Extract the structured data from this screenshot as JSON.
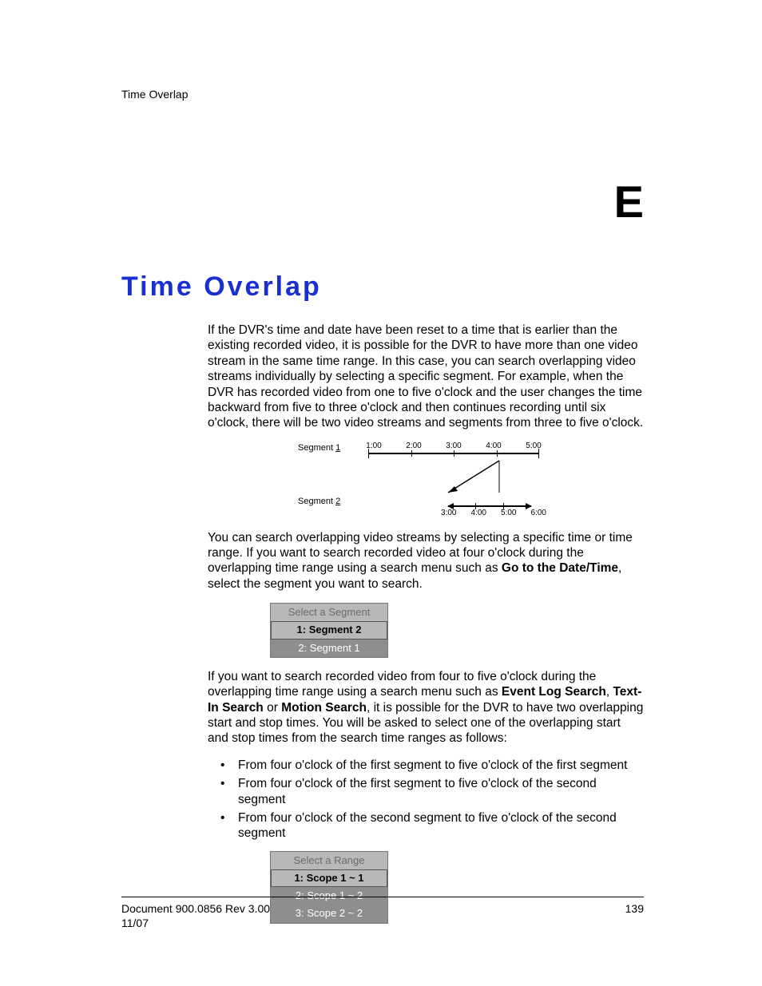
{
  "running_head": "Time Overlap",
  "section_letter": "E",
  "title": "Time Overlap",
  "para1": "If the DVR's time and date have been reset to a time that is earlier than the existing recorded video, it is possible for the DVR to have more than one video stream in the same time range. In this case, you can search overlapping video streams individually by selecting a specific segment. For example, when the DVR has recorded video from one to five o'clock and the user changes the time backward from five to three o'clock and then continues recording until six o'clock, there will be two video streams and segments from three to five o'clock.",
  "diagram": {
    "segment1_label_prefix": "Segment ",
    "segment1_label_key": "1",
    "segment1_ticks": [
      "1:00",
      "2:00",
      "3:00",
      "4:00",
      "5:00"
    ],
    "segment2_label_prefix": "Segment ",
    "segment2_label_key": "2",
    "segment2_ticks": [
      "3:00",
      "4:00",
      "5:00",
      "6:00"
    ]
  },
  "para2_pre": "You can search overlapping video streams by selecting a specific time or time range. If you want to search recorded video at four o'clock during the overlapping time range using a search menu such as ",
  "para2_bold": "Go to the Date/Time",
  "para2_post": ", select the segment you want to search.",
  "segment_menu": {
    "header": "Select a Segment",
    "rows": [
      "1: Segment 2",
      "2: Segment 1"
    ],
    "selected_index": 0
  },
  "para3_pre": "If you want to search recorded video from four to five o'clock during the overlapping time range using a search menu such as ",
  "para3_bold1": "Event Log Search",
  "para3_sep1": ", ",
  "para3_bold2": "Text-In Search",
  "para3_sep2": " or ",
  "para3_bold3": "Motion Search",
  "para3_post": ", it is possible for the DVR to have two overlapping start and stop times. You will be asked to select one of the overlapping start and stop times from the search time ranges as follows:",
  "bullets": [
    "From four o'clock of the first segment to five o'clock of the first segment",
    "From four o'clock of the first segment to five o'clock of the second segment",
    "From four o'clock of the second segment to five o'clock of the second segment"
  ],
  "range_menu": {
    "header": "Select a Range",
    "rows": [
      "1: Scope 1 ~ 1",
      "2: Scope 1 ~ 2",
      "3: Scope 2 ~ 2"
    ],
    "selected_index": 0
  },
  "footer": {
    "doc": "Document 900.0856 Rev 3.00",
    "date": "11/07",
    "page": "139"
  }
}
